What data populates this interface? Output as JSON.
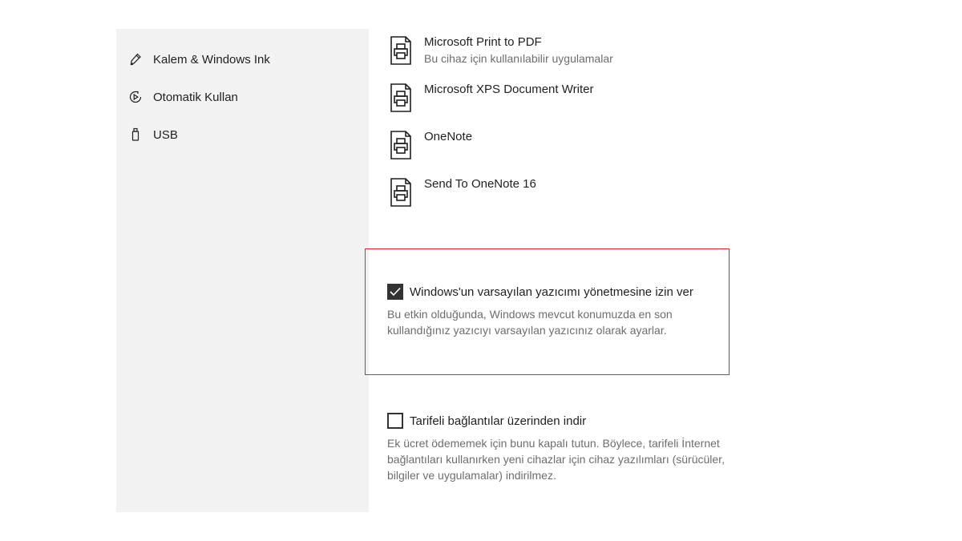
{
  "sidebar": {
    "items": [
      {
        "icon": "pen-icon",
        "label": "Kalem & Windows Ink"
      },
      {
        "icon": "autoplay-icon",
        "label": "Otomatik Kullan"
      },
      {
        "icon": "usb-icon",
        "label": "USB"
      }
    ]
  },
  "devices": [
    {
      "icon": "printer-icon",
      "name": "Microsoft Print to PDF",
      "subtitle": "Bu cihaz için kullanılabilir uygulamalar"
    },
    {
      "icon": "printer-icon",
      "name": "Microsoft XPS Document Writer",
      "subtitle": ""
    },
    {
      "icon": "printer-icon",
      "name": "OneNote",
      "subtitle": ""
    },
    {
      "icon": "printer-icon",
      "name": "Send To OneNote 16",
      "subtitle": ""
    }
  ],
  "options": {
    "default_printer": {
      "checked": true,
      "label": "Windows'un varsayılan yazıcımı yönetmesine izin ver",
      "description": "Bu etkin olduğunda, Windows mevcut konumuzda en son kullandığınız yazıcıyı varsayılan yazıcınız olarak ayarlar."
    },
    "metered_download": {
      "checked": false,
      "label": "Tarifeli bağlantılar üzerinden indir",
      "description": "Ek ücret ödememek için bunu kapalı tutun. Böylece, tarifeli İnternet bağlantıları kullanırken yeni cihazlar için cihaz yazılımları (sürücüler, bilgiler ve uygulamalar) indirilmez."
    }
  },
  "colors": {
    "highlight_border": "#e0262e",
    "sidebar_bg": "#f2f2f2",
    "checkbox_checked": "#333333"
  }
}
